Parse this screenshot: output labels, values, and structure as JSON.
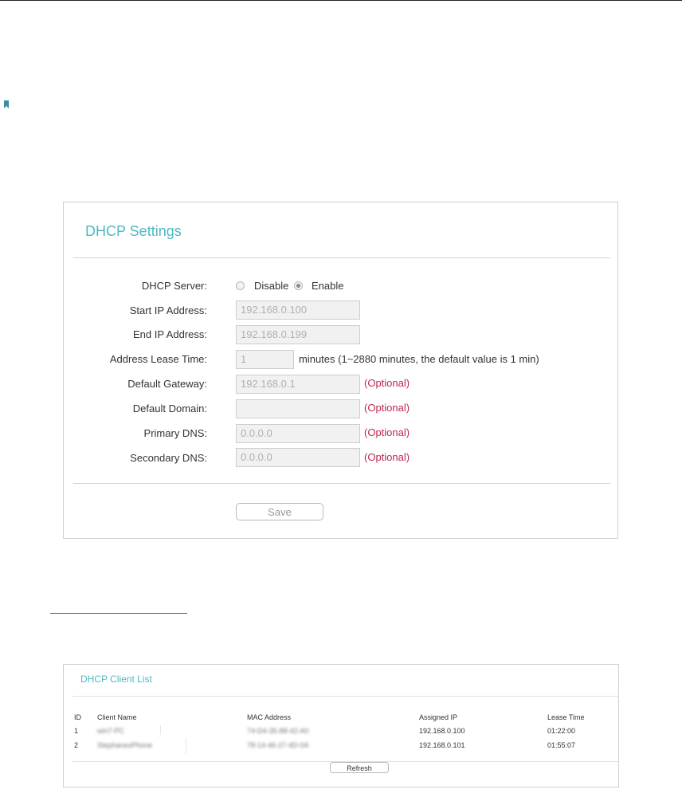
{
  "dhcp_settings": {
    "title": "DHCP Settings",
    "server": {
      "label": "DHCP Server:",
      "options": [
        "Disable",
        "Enable"
      ],
      "selected": "Enable"
    },
    "fields": [
      {
        "label": "Start IP Address:",
        "value": "192.168.0.100"
      },
      {
        "label": "End IP Address:",
        "value": "192.168.0.199"
      },
      {
        "label": "Address Lease Time:",
        "value": "1",
        "note": "minutes (1~2880 minutes, the default value is 1 min)"
      },
      {
        "label": "Default Gateway:",
        "value": "192.168.0.1",
        "optional": "(Optional)"
      },
      {
        "label": "Default Domain:",
        "value": "",
        "optional": "(Optional)"
      },
      {
        "label": "Primary DNS:",
        "value": "0.0.0.0",
        "optional": "(Optional)"
      },
      {
        "label": "Secondary DNS:",
        "value": "0.0.0.0",
        "optional": "(Optional)"
      }
    ],
    "save_label": "Save"
  },
  "client_list": {
    "title": "DHCP Client List",
    "columns": [
      "ID",
      "Client Name",
      "MAC Address",
      "Assigned IP",
      "Lease Time"
    ],
    "rows": [
      {
        "id": "1",
        "name": "win7-PC",
        "mac": "74-D4-35-88-42-A0",
        "ip": "192.168.0.100",
        "lease": "01:22:00"
      },
      {
        "id": "2",
        "name": "StephanesPhone",
        "mac": "78-14-46-27-4D-0A",
        "ip": "192.168.0.101",
        "lease": "01:55:07"
      }
    ],
    "refresh_label": "Refresh"
  },
  "colors": {
    "title_accent": "#4fb8c4",
    "optional_text": "#c0274f",
    "bookmark_icon": "#3a8fa0"
  },
  "icons": {
    "bookmark": "bookmark-icon"
  }
}
